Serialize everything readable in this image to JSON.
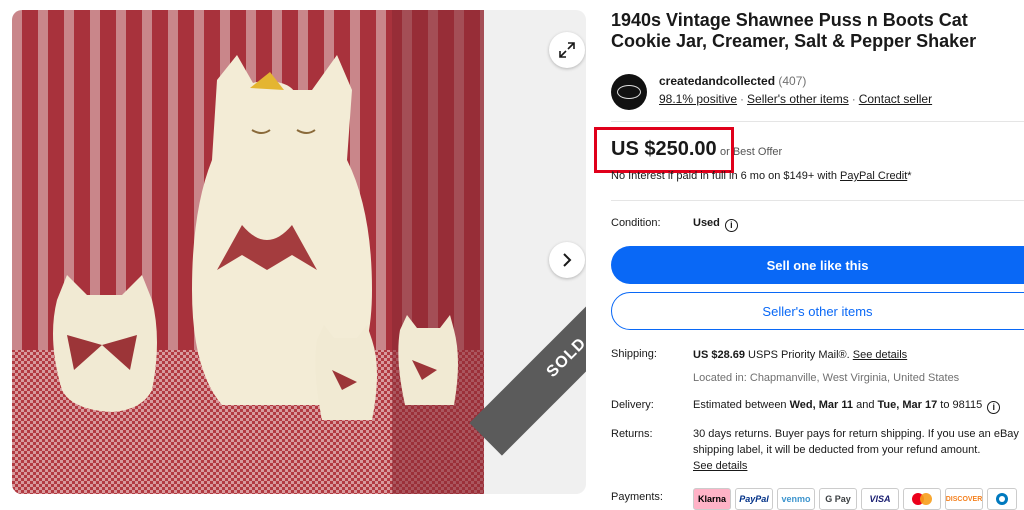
{
  "listing": {
    "title": "1940s Vintage Shawnee Puss n Boots Cat Cookie Jar, Creamer, Salt & Pepper Shaker",
    "sold_label": "SOLD"
  },
  "seller": {
    "name": "createdandcollected",
    "count": "(407)",
    "positive": "98.1% positive",
    "other_items": "Seller's other items",
    "contact": "Contact seller"
  },
  "price": {
    "amount": "US $250.00",
    "best_offer": "or Best Offer",
    "financing_text": "No Interest if paid in full in 6 mo on $149+ with",
    "financing_link": "PayPal Credit",
    "financing_suffix": "*"
  },
  "condition": {
    "label": "Condition:",
    "value": "Used"
  },
  "buttons": {
    "sell_one": "Sell one like this",
    "sellers_other": "Seller's other items"
  },
  "shipping": {
    "label": "Shipping:",
    "cost": "US $28.69",
    "service": "USPS Priority Mail",
    "reg": "®.",
    "details": "See details",
    "location": "Located in: Chapmanville, West Virginia, United States"
  },
  "delivery": {
    "label": "Delivery:",
    "prefix": "Estimated between",
    "start": "Wed, Mar 11",
    "and": "and",
    "end": "Tue, Mar 17",
    "to": "to 98115"
  },
  "returns": {
    "label": "Returns:",
    "line1": "30 days returns. Buyer pays for return shipping. If you use an eBay",
    "line2": "shipping label, it will be deducted from your refund amount.",
    "details": "See details"
  },
  "payments": {
    "label": "Payments:",
    "methods": [
      "Klarna",
      "PayPal",
      "venmo",
      "G Pay",
      "VISA",
      "",
      "DISCOVER",
      ""
    ]
  },
  "colors": {
    "accent_blue": "#0968f6",
    "highlight_red": "#e0001b",
    "sold_gray": "#5b5b5b"
  }
}
